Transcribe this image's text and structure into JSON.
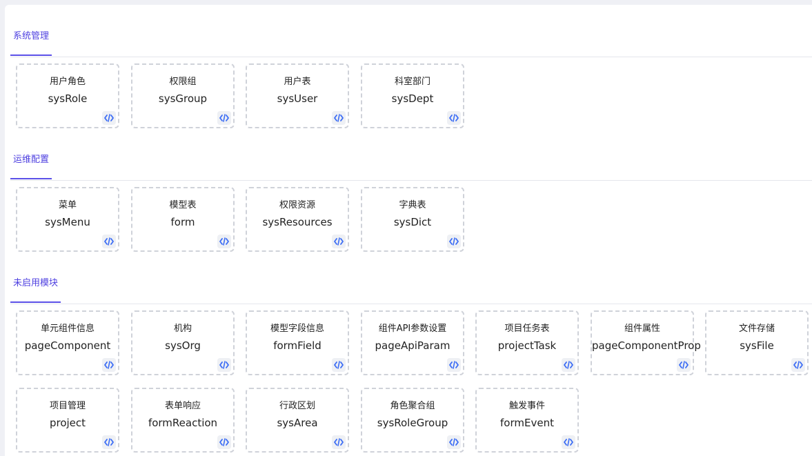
{
  "sections": [
    {
      "title": "系统管理",
      "cards": [
        {
          "title": "用户角色",
          "code": "sysRole"
        },
        {
          "title": "权限组",
          "code": "sysGroup"
        },
        {
          "title": "用户表",
          "code": "sysUser"
        },
        {
          "title": "科室部门",
          "code": "sysDept"
        }
      ]
    },
    {
      "title": "运维配置",
      "cards": [
        {
          "title": "菜单",
          "code": "sysMenu"
        },
        {
          "title": "模型表",
          "code": "form"
        },
        {
          "title": "权限资源",
          "code": "sysResources"
        },
        {
          "title": "字典表",
          "code": "sysDict"
        }
      ]
    },
    {
      "title": "未启用模块",
      "cards": [
        {
          "title": "单元组件信息",
          "code": "pageComponent"
        },
        {
          "title": "机构",
          "code": "sysOrg"
        },
        {
          "title": "模型字段信息",
          "code": "formField"
        },
        {
          "title": "组件API参数设置",
          "code": "pageApiParam"
        },
        {
          "title": "项目任务表",
          "code": "projectTask"
        },
        {
          "title": "组件属性",
          "code": "pageComponentProp"
        },
        {
          "title": "文件存储",
          "code": "sysFile"
        },
        {
          "title": "项目管理",
          "code": "project"
        },
        {
          "title": "表单响应",
          "code": "formReaction"
        },
        {
          "title": "行政区划",
          "code": "sysArea"
        },
        {
          "title": "角色聚合组",
          "code": "sysRoleGroup"
        },
        {
          "title": "触发事件",
          "code": "formEvent"
        }
      ]
    }
  ],
  "icons": {
    "card_action": "code-icon",
    "accent_color": "#3b6cf5"
  }
}
